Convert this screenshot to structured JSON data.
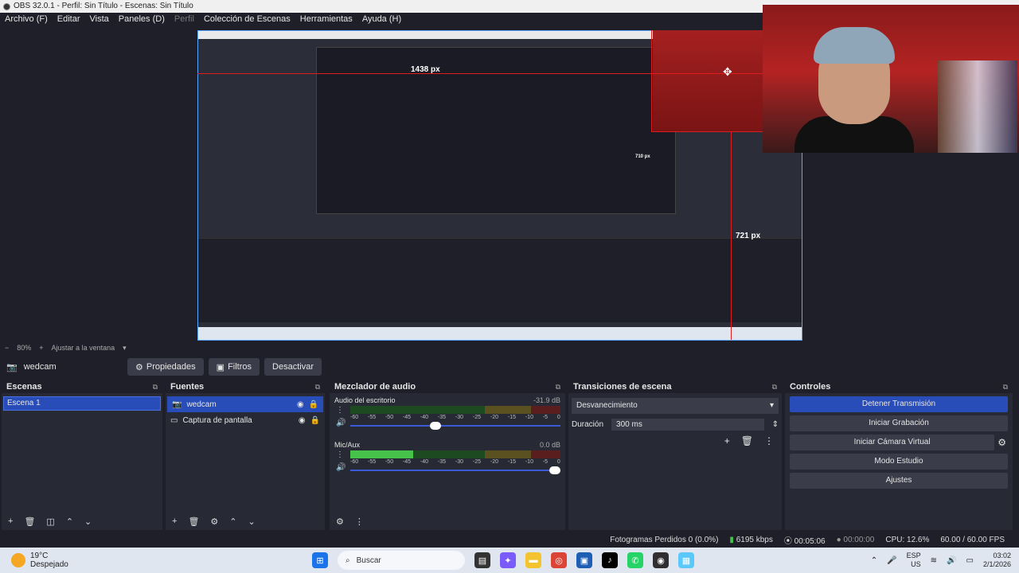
{
  "window": {
    "title": "OBS 32.0.1 - Perfil: Sin Título - Escenas: Sin Título"
  },
  "menu": {
    "items": [
      "Archivo (F)",
      "Editar",
      "Vista",
      "Paneles (D)",
      "Perfil",
      "Colección de Escenas",
      "Herramientas",
      "Ayuda (H)"
    ]
  },
  "preview": {
    "measure_width": "1438 px",
    "measure_height": "721 px",
    "measure_small": "710 px",
    "zoom": "80%",
    "fit_label": "Ajustar a la ventana"
  },
  "source_toolbar": {
    "source_name": "wedcam",
    "properties": "Propiedades",
    "filters": "Filtros",
    "deactivate": "Desactivar"
  },
  "scenes": {
    "title": "Escenas",
    "items": [
      "Escena 1"
    ]
  },
  "sources": {
    "title": "Fuentes",
    "items": [
      {
        "name": "wedcam",
        "icon": "camera-icon"
      },
      {
        "name": "Captura de pantalla",
        "icon": "monitor-icon"
      }
    ]
  },
  "mixer": {
    "title": "Mezclador de audio",
    "ticks": [
      "-60",
      "-55",
      "-50",
      "-45",
      "-40",
      "-35",
      "-30",
      "-25",
      "-20",
      "-15",
      "-10",
      "-5",
      "0"
    ],
    "channels": [
      {
        "name": "Audio del escritorio",
        "db": "-31.9 dB",
        "level": 0.0,
        "volume": 0.43
      },
      {
        "name": "Mic/Aux",
        "db": "0.0 dB",
        "level": 0.3,
        "volume": 1.0
      }
    ]
  },
  "transitions": {
    "title": "Transiciones de escena",
    "selected": "Desvanecimiento",
    "duration_label": "Duración",
    "duration": "300 ms"
  },
  "controls": {
    "title": "Controles",
    "stop_stream": "Detener Transmisión",
    "start_recording": "Iniciar Grabación",
    "start_virtual_cam": "Iniciar Cámara Virtual",
    "studio_mode": "Modo Estudio",
    "settings": "Ajustes"
  },
  "status": {
    "dropped": "Fotogramas Perdidos 0 (0.0%)",
    "bitrate": "6195 kbps",
    "stream_time": "00:05:06",
    "rec_time": "00:00:00",
    "cpu": "CPU: 12.6%",
    "fps": "60.00 / 60.00 FPS"
  },
  "taskbar": {
    "temp": "19°C",
    "weather": "Despejado",
    "search": "Buscar",
    "lang": "ESP",
    "region": "US",
    "time": "03:02",
    "date": "2/1/2026"
  },
  "colors": {
    "accent": "#284cb8",
    "red_guide": "#e01c1c",
    "meter_green": "#46c24a"
  }
}
